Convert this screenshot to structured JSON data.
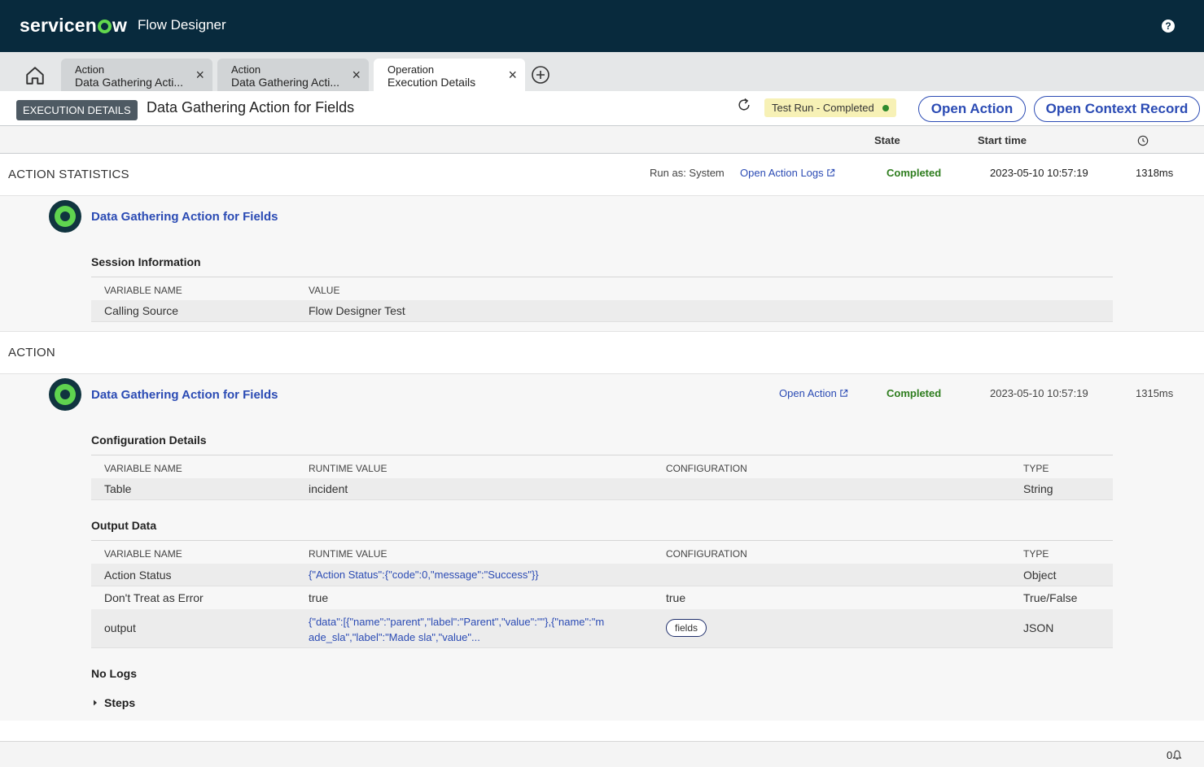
{
  "app": {
    "brand": "servicenow",
    "title": "Flow Designer"
  },
  "tabs": [
    {
      "type": "Action",
      "name": "Data Gathering Acti..."
    },
    {
      "type": "Action",
      "name": "Data Gathering Acti..."
    },
    {
      "type": "Operation",
      "name": "Execution Details"
    }
  ],
  "header": {
    "badge": "EXECUTION DETAILS",
    "title": "Data Gathering Action for Fields",
    "status": "Test Run - Completed",
    "open_action": "Open Action",
    "open_context": "Open Context Record"
  },
  "columns": {
    "state": "State",
    "start_time": "Start time"
  },
  "stats": {
    "heading": "ACTION STATISTICS",
    "run_as": "Run as: System",
    "open_logs": "Open Action Logs",
    "state": "Completed",
    "start": "2023-05-10 10:57:19",
    "duration": "1318ms",
    "action_name": "Data Gathering Action for Fields",
    "session_title": "Session Information",
    "session_cols": [
      "VARIABLE NAME",
      "VALUE"
    ],
    "session_rows": [
      {
        "name": "Calling Source",
        "value": "Flow Designer Test"
      }
    ]
  },
  "action": {
    "heading": "ACTION",
    "action_name": "Data Gathering Action for Fields",
    "open_action": "Open Action",
    "state": "Completed",
    "start": "2023-05-10 10:57:19",
    "duration": "1315ms",
    "config_title": "Configuration Details",
    "config_cols": [
      "VARIABLE NAME",
      "RUNTIME VALUE",
      "CONFIGURATION",
      "TYPE"
    ],
    "config_rows": [
      {
        "name": "Table",
        "runtime": "incident",
        "config": "",
        "type": "String"
      }
    ],
    "output_title": "Output Data",
    "output_cols": [
      "VARIABLE NAME",
      "RUNTIME VALUE",
      "CONFIGURATION",
      "TYPE"
    ],
    "output_rows": [
      {
        "name": "Action Status",
        "runtime": "{\"Action Status\":{\"code\":0,\"message\":\"Success\"}}",
        "config": "",
        "type": "Object"
      },
      {
        "name": "Don't Treat as Error",
        "runtime": "true",
        "config": "true",
        "type": "True/False"
      },
      {
        "name": "output",
        "runtime_line1": "{\"data\":[{\"name\":\"parent\",\"label\":\"Parent\",\"value\":\"\"},{\"name\":\"m",
        "runtime_line2": "ade_sla\",\"label\":\"Made sla\",\"value\"...",
        "config": "fields",
        "type": "JSON"
      }
    ],
    "no_logs": "No Logs",
    "steps": "Steps"
  },
  "footer": {
    "notification_count": "0"
  },
  "colors": {
    "topbar": "#082a3d",
    "accent": "#2b4bb4",
    "success": "#2e7d1e",
    "logo_green": "#62d84e"
  }
}
